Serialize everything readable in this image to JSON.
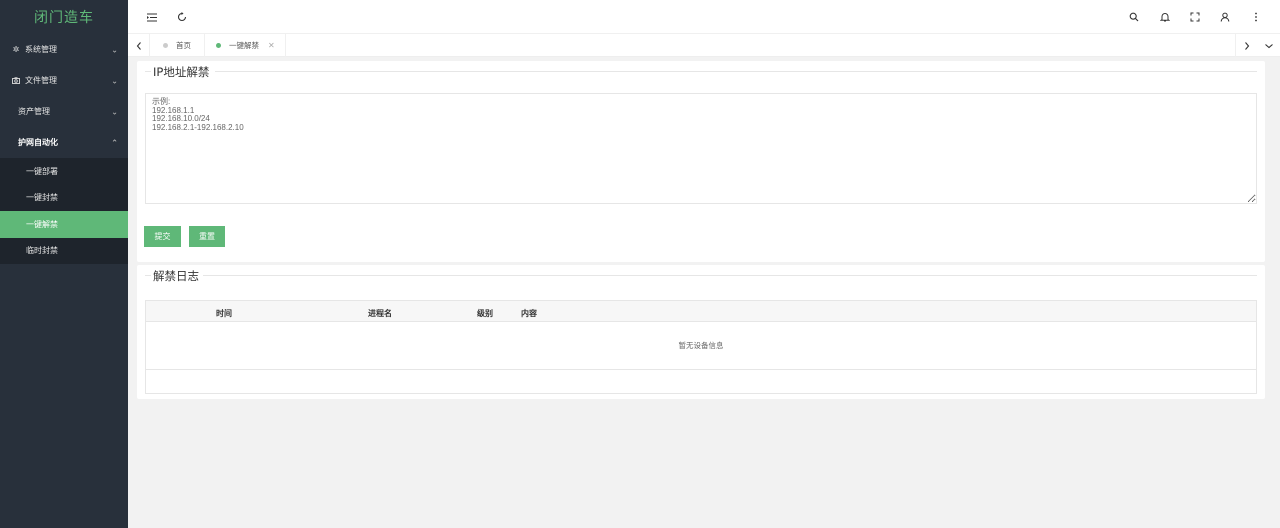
{
  "app": {
    "logo": "闭门造车"
  },
  "sidebar": {
    "items": [
      {
        "label": "系统管理",
        "icon": "gear-icon"
      },
      {
        "label": "文件管理",
        "icon": "camera-icon"
      },
      {
        "label": "资产管理"
      },
      {
        "label": "护网自动化",
        "open": true,
        "children": [
          {
            "label": "一键部署"
          },
          {
            "label": "一键封禁"
          },
          {
            "label": "一键解禁",
            "active": true
          },
          {
            "label": "临时封禁"
          }
        ]
      }
    ]
  },
  "header": {
    "left_icons": [
      "menu-fold-icon",
      "refresh-icon"
    ],
    "right_icons": [
      "search-icon",
      "bell-icon",
      "fullscreen-icon",
      "user-icon",
      "more-vertical-icon"
    ]
  },
  "tabs": [
    {
      "label": "首页",
      "active": false
    },
    {
      "label": "一键解禁",
      "active": true,
      "closable": true
    }
  ],
  "unban": {
    "title": "IP地址解禁",
    "placeholder": "示例:\n192.168.1.1\n192.168.10.0/24\n192.168.2.1-192.168.2.10",
    "submit_label": "提交",
    "reset_label": "重置"
  },
  "log": {
    "title": "解禁日志",
    "columns": [
      "时间",
      "进程名",
      "级别",
      "内容"
    ],
    "empty_text": "暂无设备信息"
  },
  "colors": {
    "accent": "#5fb878",
    "sidebar": "#28303b",
    "submenu": "#1e242c"
  }
}
